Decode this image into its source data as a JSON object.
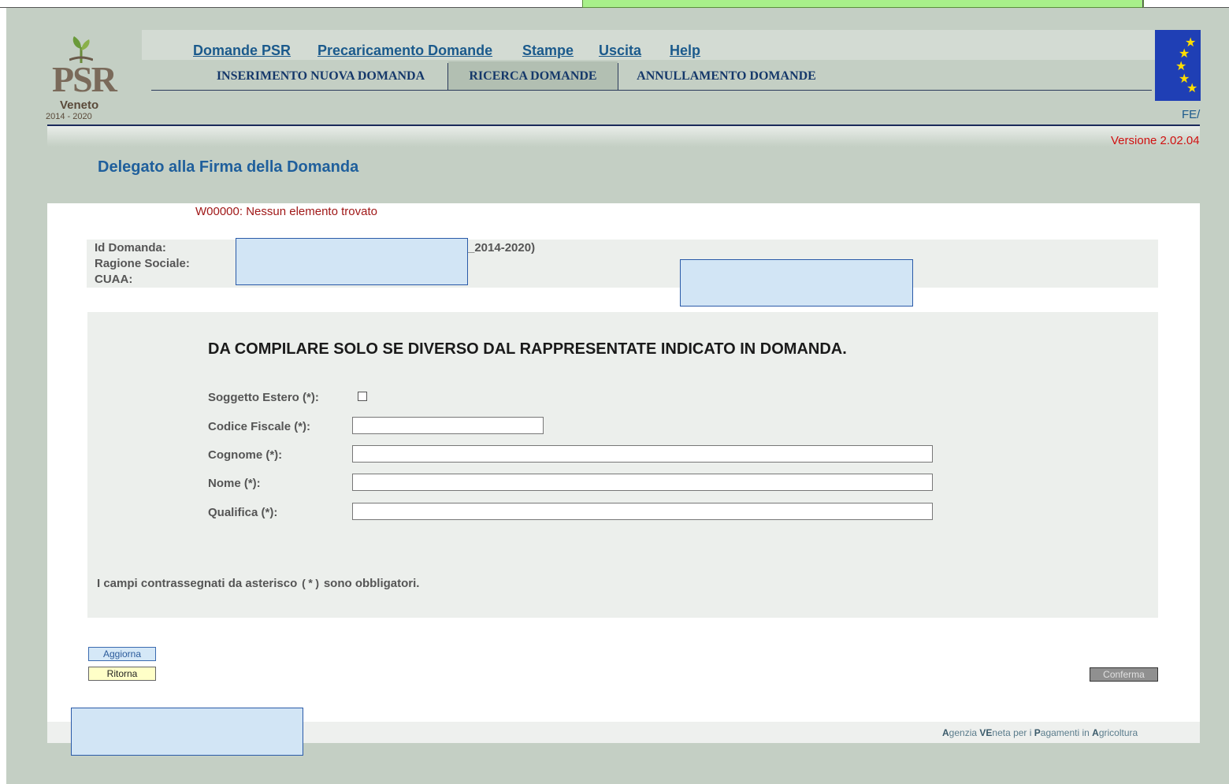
{
  "nav": {
    "primary": [
      {
        "label": "Domande PSR"
      },
      {
        "label": "Precaricamento Domande"
      },
      {
        "label": "Stampe"
      },
      {
        "label": "Uscita"
      },
      {
        "label": "Help"
      }
    ],
    "tabs": [
      {
        "label": "INSERIMENTO NUOVA DOMANDA"
      },
      {
        "label": "RICERCA DOMANDE",
        "active": true
      },
      {
        "label": "ANNULLAMENTO DOMANDE"
      }
    ]
  },
  "logo": {
    "text": "PSR",
    "region": "Veneto",
    "years": "2014 - 2020"
  },
  "eu": {
    "fund_label": "FE/"
  },
  "version": "Versione 2.02.04",
  "page_title": "Delegato alla Firma della Domanda",
  "warning": "W00000: Nessun elemento trovato",
  "info": {
    "id_domanda_label": "Id Domanda:",
    "ragione_sociale_label": "Ragione Sociale:",
    "cuaa_label": "CUAA:",
    "id_suffix": "_2014-2020)"
  },
  "form": {
    "heading": "DA COMPILARE SOLO SE DIVERSO DAL RAPPRESENTATE INDICATO IN DOMANDA.",
    "soggetto_estero_label": "Soggetto Estero (*):",
    "soggetto_estero_checked": false,
    "codice_fiscale_label": "Codice Fiscale (*):",
    "codice_fiscale_value": "",
    "cognome_label": "Cognome (*):",
    "cognome_value": "",
    "nome_label": "Nome (*):",
    "nome_value": "",
    "qualifica_label": "Qualifica (*):",
    "qualifica_value": "",
    "required_note_pre": "I campi contrassegnati da asterisco ",
    "required_note_mark": "(*)",
    "required_note_post": " sono obbligatori."
  },
  "buttons": {
    "aggiorna": "Aggiorna",
    "ritorna": "Ritorna",
    "conferma": "Conferma"
  },
  "footer": {
    "agency": [
      {
        "b": "A",
        "t": "genzia "
      },
      {
        "b": "VE",
        "t": "neta per i "
      },
      {
        "b": "P",
        "t": "agamenti in "
      },
      {
        "b": "A",
        "t": "gricoltura"
      }
    ]
  },
  "colors": {
    "link": "#1b5a8c",
    "warning": "#a01818",
    "version": "#d01010",
    "frame": "#c4cfc4"
  }
}
